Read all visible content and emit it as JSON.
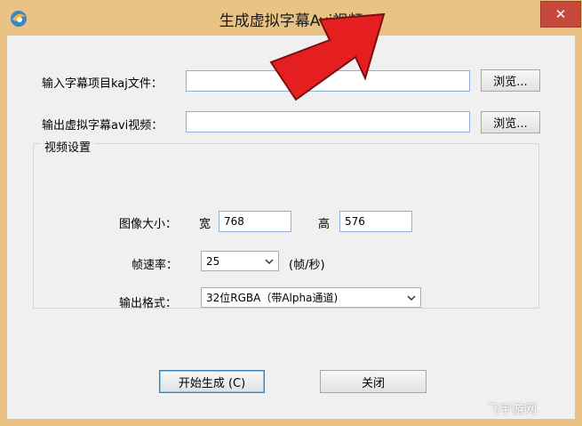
{
  "window": {
    "title": "生成虚拟字幕Avi视频",
    "close_symbol": "✕"
  },
  "form": {
    "input_label": "输入字幕项目kaj文件：",
    "input_value": "",
    "output_label": "输出虚拟字幕avi视频：",
    "output_value": "",
    "browse_label": "浏览..."
  },
  "video_settings": {
    "group_title": "视频设置",
    "image_size_label": "图像大小：",
    "width_label": "宽",
    "width_value": "768",
    "height_label": "高",
    "height_value": "576",
    "fps_label": "帧速率：",
    "fps_value": "25",
    "fps_unit": "(帧/秒)",
    "format_label": "输出格式：",
    "format_value": "32位RGBA（带Alpha通道)"
  },
  "buttons": {
    "start_label": "开始生成 (C)",
    "close_label": "关闭"
  },
  "watermark": "飞宇游网",
  "colors": {
    "frame": "#e9c383",
    "client": "#f0f0f0",
    "close_button": "#c7493c",
    "annotation_arrow": "#e51f1f"
  }
}
